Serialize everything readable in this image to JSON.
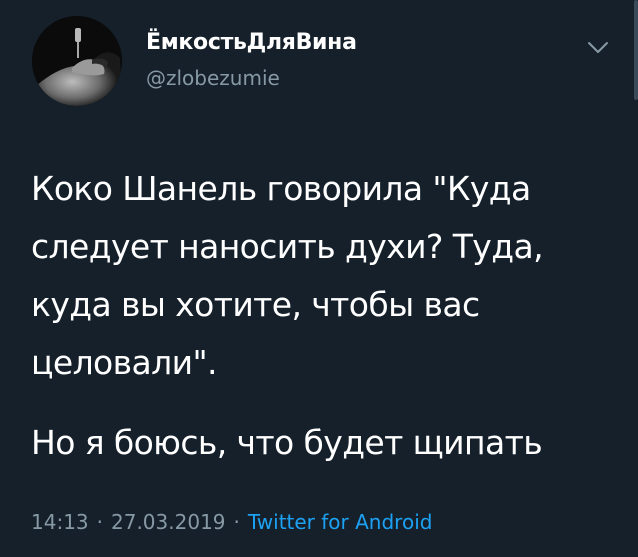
{
  "author": {
    "display_name": "ЁмкостьДляВина",
    "handle": "@zlobezumie",
    "avatar_icon": "avatar-photo"
  },
  "tweet": {
    "paragraph_1": "Коко Шанель говорила \"Куда\nследует наносить духи? Туда,\nкуда вы хотите, чтобы вас\nцеловали\".",
    "paragraph_2": "Но я боюсь, что будет щипать"
  },
  "meta": {
    "time": "14:13",
    "separator_1": "·",
    "date": "27.03.2019",
    "separator_2": "·",
    "source": "Twitter for Android"
  },
  "menu": {
    "icon": "chevron-down-icon"
  },
  "colors": {
    "background": "#15202b",
    "text_primary": "#ffffff",
    "text_secondary": "#8899a6",
    "link": "#1da1f2"
  }
}
